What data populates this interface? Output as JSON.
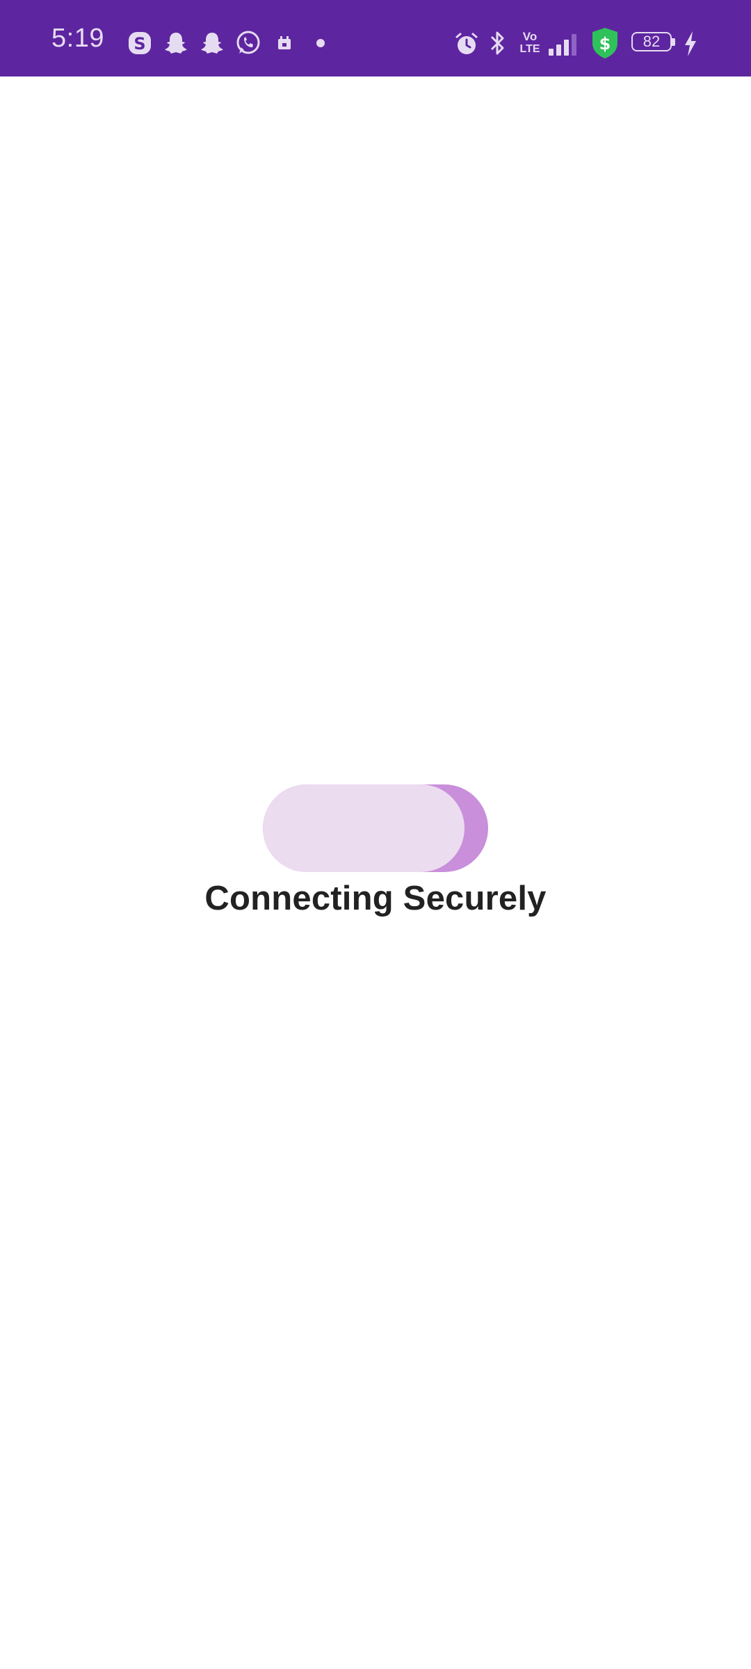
{
  "status_bar": {
    "time": "5:19",
    "battery_level": "82",
    "network_label_top": "Vo",
    "network_label_bottom": "LTE",
    "background_color": "#5e25a0",
    "icon_color": "#e6dcf2",
    "notification_icons": [
      "skype-icon",
      "snapchat-icon",
      "snapchat-icon",
      "whatsapp-icon",
      "calendar-icon",
      "dot-icon"
    ],
    "system_icons": [
      "alarm-icon",
      "bluetooth-icon",
      "volte-icon",
      "signal-icon",
      "security-shield-icon",
      "battery-icon",
      "charging-icon"
    ],
    "shield_color": "#2fc15a"
  },
  "loader": {
    "base_color": "#ecdcf0",
    "accent_color": "#c98fda"
  },
  "main": {
    "status_text": "Connecting Securely"
  }
}
